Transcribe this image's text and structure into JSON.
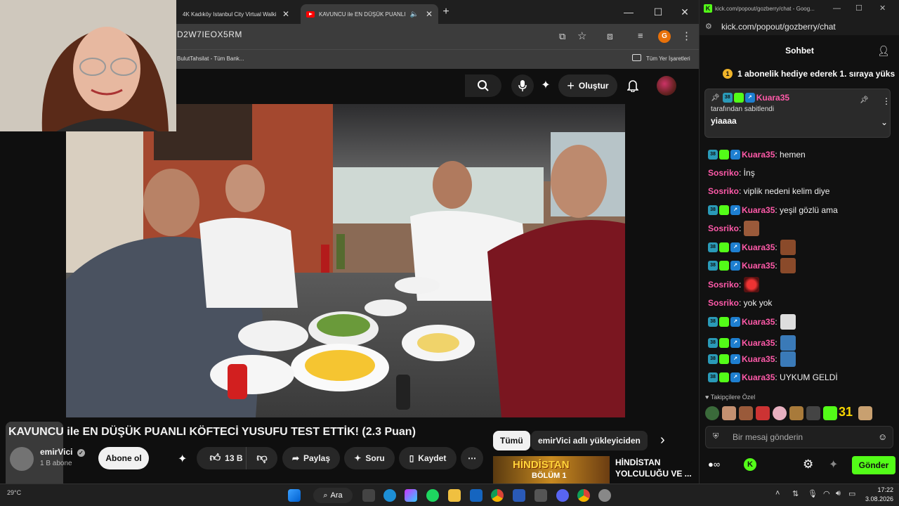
{
  "browser": {
    "tabs": [
      {
        "label": "4K Kadıköy Istanbul City Virtual Walki"
      },
      {
        "label": "KAVUNCU ile EN DÜŞÜK PUANLI"
      }
    ],
    "new_tab": "+",
    "address": "D2W7IEOX5RM",
    "profile_initial": "G",
    "bookmarks": [
      "BulutTahsilat - Tüm Bank...",
      "Tüm Yer İşaretleri"
    ]
  },
  "youtube": {
    "create_label": "Oluştur",
    "video_title": "KAVUNCU ile EN DÜŞÜK PUANLI KÖFTECİ YUSUFU TEST ETTİK! (2.3 Puan)",
    "channel_name": "emirVici",
    "subscribers": "1 B abone",
    "subscribe_label": "Abone ol",
    "like_count": "13 B",
    "share_label": "Paylaş",
    "ask_label": "Soru",
    "save_label": "Kaydet",
    "more_label": "⋯",
    "chips": [
      "Tümü",
      "emirVici adlı yükleyiciden"
    ],
    "rec_thumb_text": "HİNDİSTAN",
    "rec_thumb_sub": "BÖLÜM 1",
    "rec_title": "HİNDİSTAN YOLCULUĞU VE ..."
  },
  "chat": {
    "window_title": "kick.com/popout/gozberry/chat - Goog...",
    "url": "kick.com/popout/gozberry/chat",
    "header": "Sohbet",
    "sub_gift_text": "1 abonelik hediye ederek 1. sıraya yüks",
    "pinned": {
      "user": "Kuara35",
      "pinned_by": "tarafından sabitlendi",
      "text": "yiaaaa"
    },
    "messages": [
      {
        "user": "Kuara35",
        "text": ": hemen"
      },
      {
        "user": "Sosriko",
        "text": ": İnş"
      },
      {
        "user": "Sosriko",
        "text": ": viplik nedeni kelim diye"
      },
      {
        "user": "Kuara35",
        "text": ": yeşil gözlü ama"
      },
      {
        "user": "Sosriko",
        "text": ":"
      },
      {
        "user": "Kuara35",
        "text": ":"
      },
      {
        "user": "Kuara35",
        "text": ":"
      },
      {
        "user": "Sosriko",
        "text": ":"
      },
      {
        "user": "Sosriko",
        "text": ": yok yok"
      },
      {
        "user": "Kuara35",
        "text": ":"
      },
      {
        "user": "Kuara35",
        "text": ":"
      },
      {
        "user": "Kuara35",
        "text": ":"
      },
      {
        "user": "Kuara35",
        "text": ": UYKUM GELDİ"
      }
    ],
    "followers_label": "Takipçilere Özel",
    "input_placeholder": "Bir mesaj gönderin",
    "send_label": "Gönder",
    "badge_num": "38",
    "emote_count": "31"
  },
  "taskbar": {
    "search_label": "Ara",
    "time": "17:22",
    "date": "3.08.2026",
    "weather": "29°C"
  },
  "colors": {
    "kick_green": "#53fc18",
    "username_pink": "#ff5aa9",
    "youtube_red": "#ff0000"
  }
}
